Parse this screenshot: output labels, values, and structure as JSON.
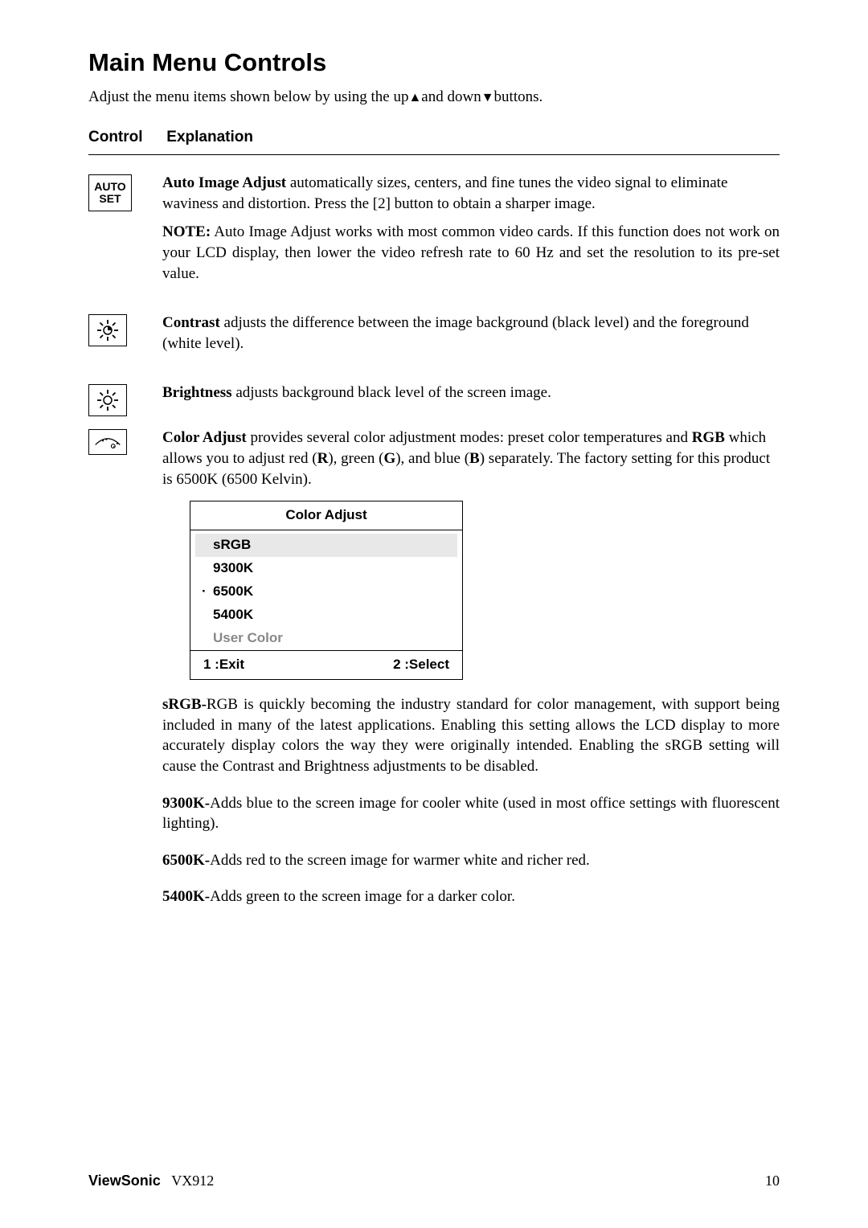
{
  "title": "Main Menu Controls",
  "intro_before": "Adjust the menu items shown below by using the up",
  "intro_between": "and down",
  "intro_after": "buttons.",
  "header": {
    "control": "Control",
    "explanation": "Explanation"
  },
  "autoset": {
    "line1": "AUTO",
    "line2": "SET"
  },
  "auto_image": {
    "bold": "Auto Image Adjust",
    "text": " automatically sizes, centers, and fine tunes the video signal to eliminate waviness and distortion. Press the [2] button to obtain a sharper image.",
    "note_label": "NOTE:",
    "note_text": " Auto Image Adjust works with most common video cards. If this function does not work on your LCD display, then lower the video refresh rate to 60 Hz and set the resolution to its pre-set value."
  },
  "contrast": {
    "bold": "Contrast",
    "text": " adjusts the difference between the image background  (black level) and the foreground (white level)."
  },
  "brightness": {
    "bold": "Brightness",
    "text": " adjusts background black level of the screen image."
  },
  "color_adjust": {
    "bold": "Color Adjust",
    "t1": " provides several color adjustment modes: preset color temperatures and ",
    "rgb": "RGB",
    "t2": " which allows you to adjust red (",
    "r": "R",
    "t3": "), green (",
    "g": "G",
    "t4": "), and blue (",
    "b": "B",
    "t5": ") separately. The factory setting for this product is 6500K (6500 Kelvin)."
  },
  "osd": {
    "title": "Color Adjust",
    "srgb": "sRGB",
    "k9300": "9300K",
    "k6500": "6500K",
    "k5400": "5400K",
    "user": "User Color",
    "exit": "1 :Exit",
    "select": "2 :Select"
  },
  "srgb": {
    "bold": "sRGB-",
    "text": "RGB is quickly becoming the industry standard for color management, with support being included in many of the latest applications. Enabling this setting allows the LCD display to more accurately display colors the way they were originally intended. Enabling the sRGB setting will cause the Contrast and Brightness adjustments to be disabled."
  },
  "k9300": {
    "bold": "9300K-",
    "text": "Adds blue to the screen image for cooler white (used in most office settings with fluorescent lighting)."
  },
  "k6500": {
    "bold": "6500K-",
    "text": "Adds red to the screen image for warmer white and richer red."
  },
  "k5400": {
    "bold": "5400K-",
    "text": "Adds green to the screen image for a darker color."
  },
  "footer": {
    "brand": "ViewSonic",
    "model": "VX912",
    "page": "10"
  }
}
